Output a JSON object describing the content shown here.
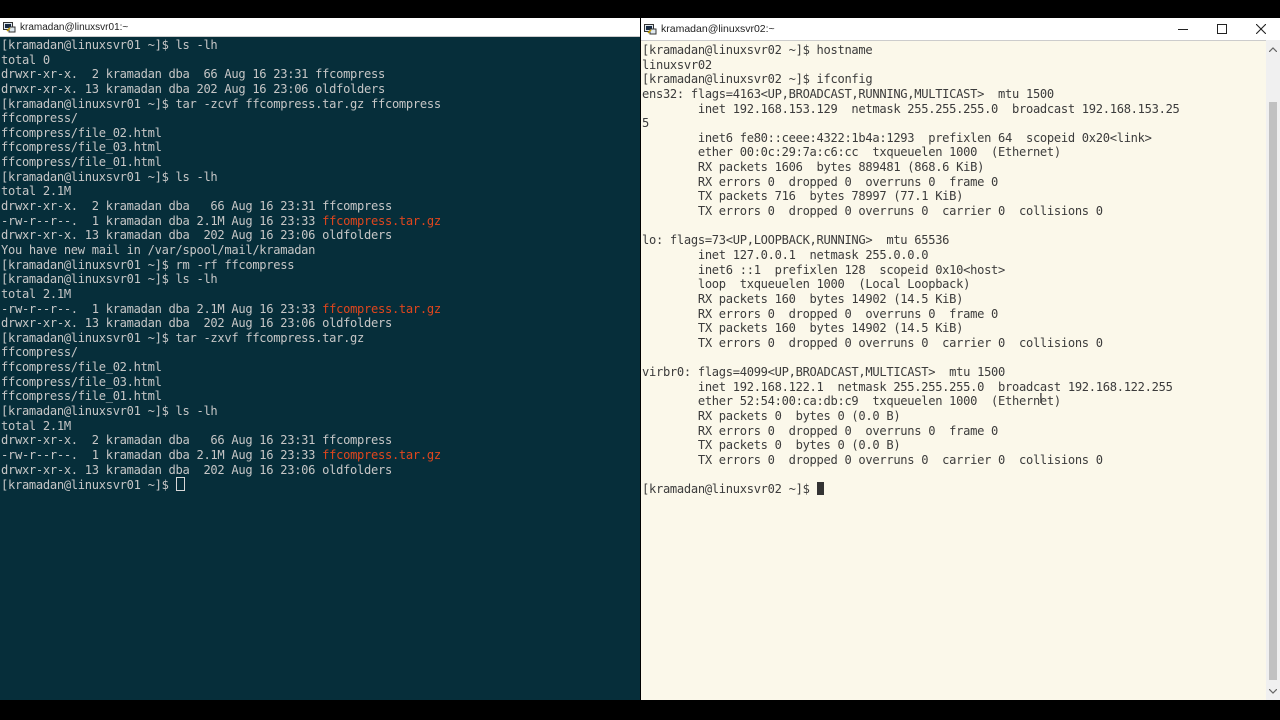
{
  "left_window": {
    "title": "kramadan@linuxsvr01:~",
    "lines": [
      {
        "text": "[kramadan@linuxsvr01 ~]$ ls -lh"
      },
      {
        "text": "total 0"
      },
      {
        "text": "drwxr-xr-x.  2 kramadan dba  66 Aug 16 23:31 ffcompress"
      },
      {
        "text": "drwxr-xr-x. 13 kramadan dba 202 Aug 16 23:06 oldfolders"
      },
      {
        "text": "[kramadan@linuxsvr01 ~]$ tar -zcvf ffcompress.tar.gz ffcompress"
      },
      {
        "text": "ffcompress/"
      },
      {
        "text": "ffcompress/file_02.html"
      },
      {
        "text": "ffcompress/file_03.html"
      },
      {
        "text": "ffcompress/file_01.html"
      },
      {
        "text": "[kramadan@linuxsvr01 ~]$ ls -lh"
      },
      {
        "text": "total 2.1M"
      },
      {
        "text": "drwxr-xr-x.  2 kramadan dba   66 Aug 16 23:31 ffcompress"
      },
      {
        "text": "-rw-r--r--.  1 kramadan dba 2.1M Aug 16 23:33 ",
        "hl": "ffcompress.tar.gz"
      },
      {
        "text": "drwxr-xr-x. 13 kramadan dba  202 Aug 16 23:06 oldfolders"
      },
      {
        "text": "You have new mail in /var/spool/mail/kramadan"
      },
      {
        "text": "[kramadan@linuxsvr01 ~]$ rm -rf ffcompress"
      },
      {
        "text": "[kramadan@linuxsvr01 ~]$ ls -lh"
      },
      {
        "text": "total 2.1M"
      },
      {
        "text": "-rw-r--r--.  1 kramadan dba 2.1M Aug 16 23:33 ",
        "hl": "ffcompress.tar.gz"
      },
      {
        "text": "drwxr-xr-x. 13 kramadan dba  202 Aug 16 23:06 oldfolders"
      },
      {
        "text": "[kramadan@linuxsvr01 ~]$ tar -zxvf ffcompress.tar.gz"
      },
      {
        "text": "ffcompress/"
      },
      {
        "text": "ffcompress/file_02.html"
      },
      {
        "text": "ffcompress/file_03.html"
      },
      {
        "text": "ffcompress/file_01.html"
      },
      {
        "text": "[kramadan@linuxsvr01 ~]$ ls -lh"
      },
      {
        "text": "total 2.1M"
      },
      {
        "text": "drwxr-xr-x.  2 kramadan dba   66 Aug 16 23:31 ffcompress"
      },
      {
        "text": "-rw-r--r--.  1 kramadan dba 2.1M Aug 16 23:33 ",
        "hl": "ffcompress.tar.gz"
      },
      {
        "text": "drwxr-xr-x. 13 kramadan dba  202 Aug 16 23:06 oldfolders"
      },
      {
        "text": "[kramadan@linuxsvr01 ~]$ ",
        "cursor": "box"
      }
    ]
  },
  "right_window": {
    "title": "kramadan@linuxsvr02:~",
    "lines": [
      {
        "text": "[kramadan@linuxsvr02 ~]$ hostname"
      },
      {
        "text": "linuxsvr02"
      },
      {
        "text": "[kramadan@linuxsvr02 ~]$ ifconfig"
      },
      {
        "text": "ens32: flags=4163<UP,BROADCAST,RUNNING,MULTICAST>  mtu 1500"
      },
      {
        "text": "        inet 192.168.153.129  netmask 255.255.255.0  broadcast 192.168.153.25"
      },
      {
        "text": "5"
      },
      {
        "text": "        inet6 fe80::ceee:4322:1b4a:1293  prefixlen 64  scopeid 0x20<link>"
      },
      {
        "text": "        ether 00:0c:29:7a:c6:cc  txqueuelen 1000  (Ethernet)"
      },
      {
        "text": "        RX packets 1606  bytes 889481 (868.6 KiB)"
      },
      {
        "text": "        RX errors 0  dropped 0  overruns 0  frame 0"
      },
      {
        "text": "        TX packets 716  bytes 78997 (77.1 KiB)"
      },
      {
        "text": "        TX errors 0  dropped 0 overruns 0  carrier 0  collisions 0"
      },
      {
        "text": ""
      },
      {
        "text": "lo: flags=73<UP,LOOPBACK,RUNNING>  mtu 65536"
      },
      {
        "text": "        inet 127.0.0.1  netmask 255.0.0.0"
      },
      {
        "text": "        inet6 ::1  prefixlen 128  scopeid 0x10<host>"
      },
      {
        "text": "        loop  txqueuelen 1000  (Local Loopback)"
      },
      {
        "text": "        RX packets 160  bytes 14902 (14.5 KiB)"
      },
      {
        "text": "        RX errors 0  dropped 0  overruns 0  frame 0"
      },
      {
        "text": "        TX packets 160  bytes 14902 (14.5 KiB)"
      },
      {
        "text": "        TX errors 0  dropped 0 overruns 0  carrier 0  collisions 0"
      },
      {
        "text": ""
      },
      {
        "text": "virbr0: flags=4099<UP,BROADCAST,MULTICAST>  mtu 1500"
      },
      {
        "text": "        inet 192.168.122.1  netmask 255.255.255.0  broadcast 192.168.122.255"
      },
      {
        "text": "        ether 52:54:00:ca:db:c9  txqueuelen 1000  (Ethernet)"
      },
      {
        "text": "        RX packets 0  bytes 0 (0.0 B)"
      },
      {
        "text": "        RX errors 0  dropped 0  overruns 0  frame 0"
      },
      {
        "text": "        TX packets 0  bytes 0 (0.0 B)"
      },
      {
        "text": "        TX errors 0  dropped 0 overruns 0  carrier 0  collisions 0"
      },
      {
        "text": ""
      },
      {
        "text": "[kramadan@linuxsvr02 ~]$ ",
        "cursor": "block"
      }
    ]
  },
  "window_controls": {
    "minimize_icon": "minimize-icon",
    "maximize_icon": "maximize-icon",
    "close_icon": "close-icon"
  },
  "colors": {
    "left_background": "#062e3a",
    "right_background": "#fbf8ea",
    "highlight_file": "#e0461d"
  }
}
